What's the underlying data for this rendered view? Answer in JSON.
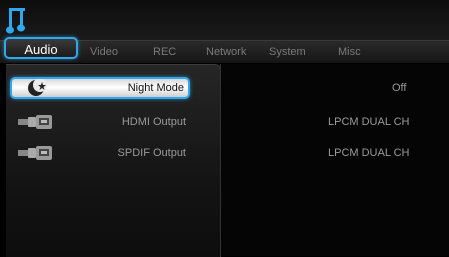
{
  "tabs": [
    {
      "label": "Audio",
      "active": true
    },
    {
      "label": "Video"
    },
    {
      "label": "REC"
    },
    {
      "label": "Network"
    },
    {
      "label": "System"
    },
    {
      "label": "Misc"
    }
  ],
  "settings": [
    {
      "label": "Night Mode",
      "value": "Off",
      "icon": "moon-star-icon",
      "selected": true
    },
    {
      "label": "HDMI Output",
      "value": "LPCM DUAL CH",
      "icon": "hdmi-connector-icon"
    },
    {
      "label": "SPDIF Output",
      "value": "LPCM DUAL CH",
      "icon": "spdif-connector-icon"
    }
  ],
  "colors": {
    "accent": "#2fa8f0",
    "text_dim": "#9a9a9a"
  }
}
